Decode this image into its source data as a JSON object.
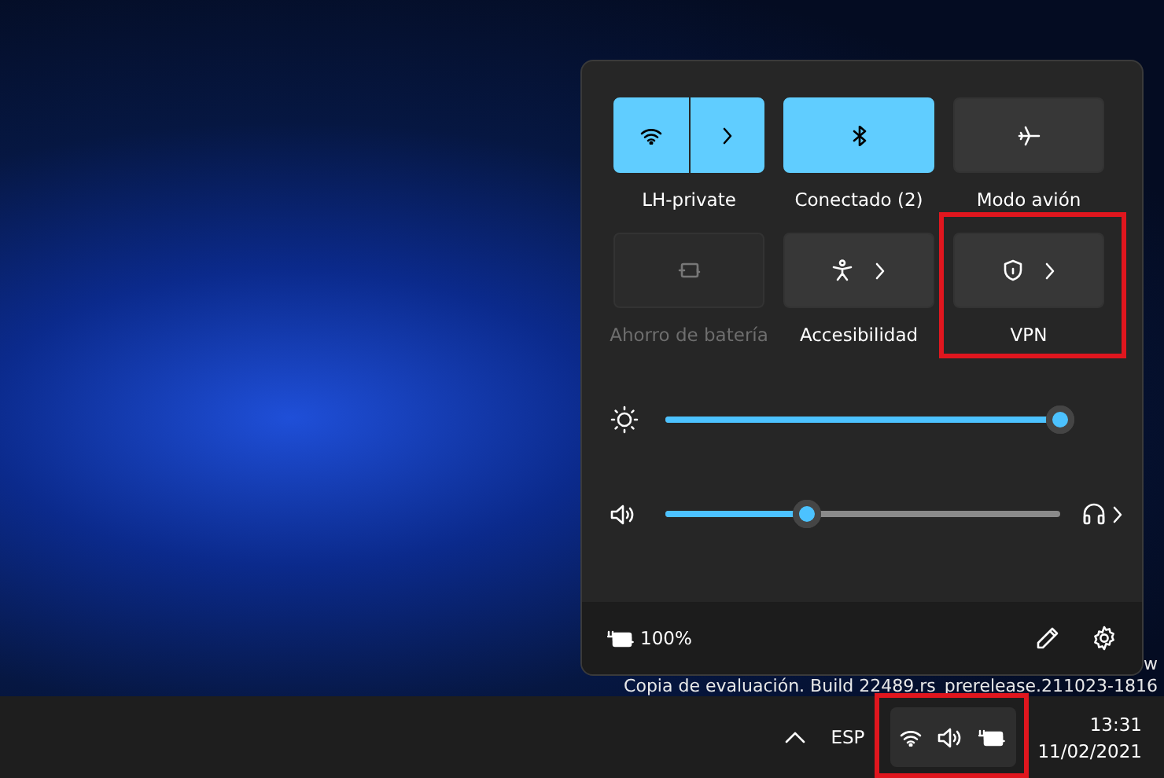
{
  "quick_settings": {
    "tiles": [
      {
        "kind": "split",
        "label": "LH-private",
        "on": true,
        "disabled": false,
        "highlighted": false
      },
      {
        "kind": "toggle",
        "label": "Conectado (2)",
        "on": true,
        "disabled": false,
        "highlighted": false
      },
      {
        "kind": "toggle",
        "label": "Modo avión",
        "on": false,
        "disabled": false,
        "highlighted": false
      },
      {
        "kind": "toggle",
        "label": "Ahorro de batería",
        "on": false,
        "disabled": true,
        "highlighted": false
      },
      {
        "kind": "expand",
        "label": "Accesibilidad",
        "on": false,
        "disabled": false,
        "highlighted": false
      },
      {
        "kind": "expand",
        "label": "VPN",
        "on": false,
        "disabled": false,
        "highlighted": true
      }
    ],
    "sliders": [
      {
        "kind": "brightness",
        "level": 1.0
      },
      {
        "kind": "volume",
        "level": 0.36
      }
    ],
    "footer": {
      "battery": "100%"
    }
  },
  "watermark": {
    "line_1": "w",
    "line_2": "Copia de evaluación. Build 22489.rs_prerelease.211023-1816"
  },
  "taskbar": {
    "language": "ESP",
    "tray_highlighted": true,
    "time": "13:31",
    "date": "11/02/2021"
  }
}
